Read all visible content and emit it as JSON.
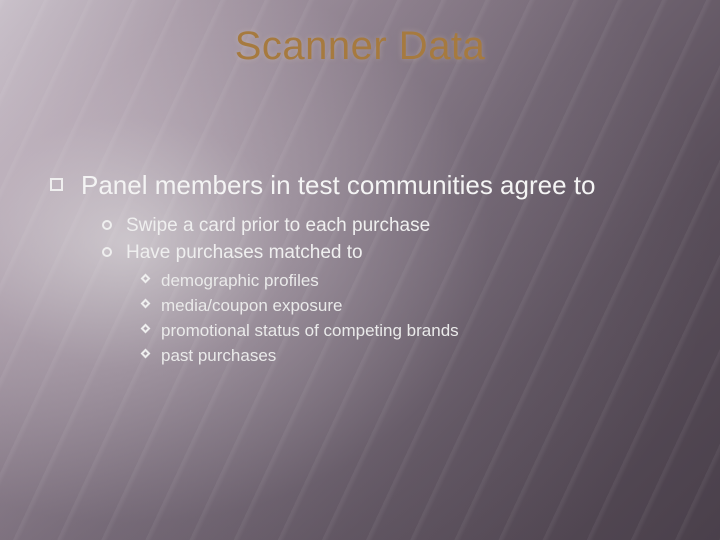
{
  "title": "Scanner Data",
  "level1": {
    "text": "Panel members in test communities agree to"
  },
  "level2": [
    {
      "text": "Swipe a card prior to each purchase"
    },
    {
      "text": "Have purchases matched to"
    }
  ],
  "level3": [
    {
      "text": "demographic profiles"
    },
    {
      "text": "media/coupon exposure"
    },
    {
      "text": "promotional status of competing brands"
    },
    {
      "text": "past purchases"
    }
  ]
}
